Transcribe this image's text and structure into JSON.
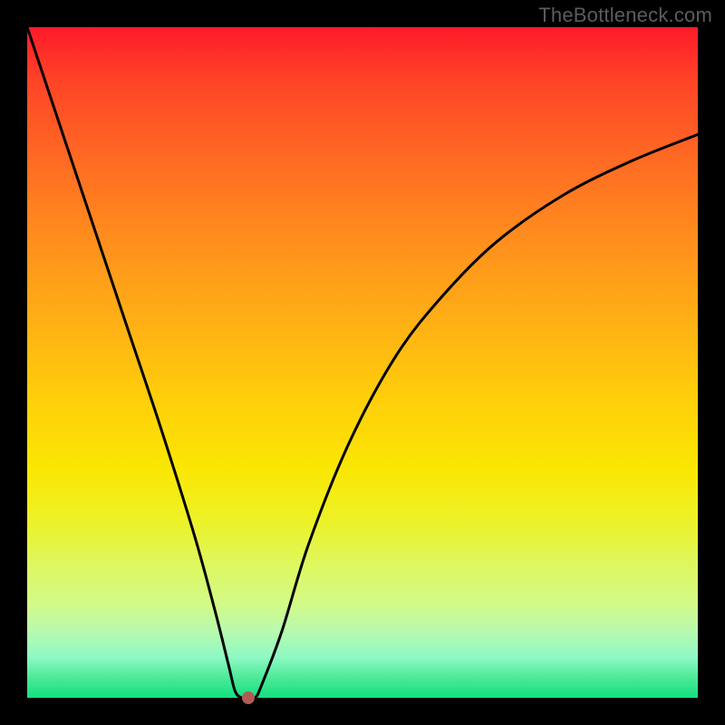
{
  "watermark": "TheBottleneck.com",
  "chart_data": {
    "type": "line",
    "title": "",
    "xlabel": "",
    "ylabel": "",
    "xlim": [
      0,
      100
    ],
    "ylim": [
      0,
      100
    ],
    "grid": false,
    "legend": false,
    "series": [
      {
        "name": "curve",
        "x": [
          0,
          5,
          10,
          15,
          20,
          25,
          28,
          30,
          31,
          32,
          33,
          34,
          35,
          38,
          42,
          48,
          55,
          62,
          70,
          80,
          90,
          100
        ],
        "y": [
          100,
          85,
          70,
          55,
          40,
          24,
          13,
          5,
          1,
          0,
          0,
          0,
          2,
          10,
          23,
          38,
          51,
          60,
          68,
          75,
          80,
          84
        ]
      }
    ],
    "marker": {
      "x": 33,
      "y": 0
    }
  },
  "colors": {
    "frame": "#000000",
    "curve": "#000000",
    "marker": "#b35a56",
    "watermark": "#5c5c5c"
  }
}
